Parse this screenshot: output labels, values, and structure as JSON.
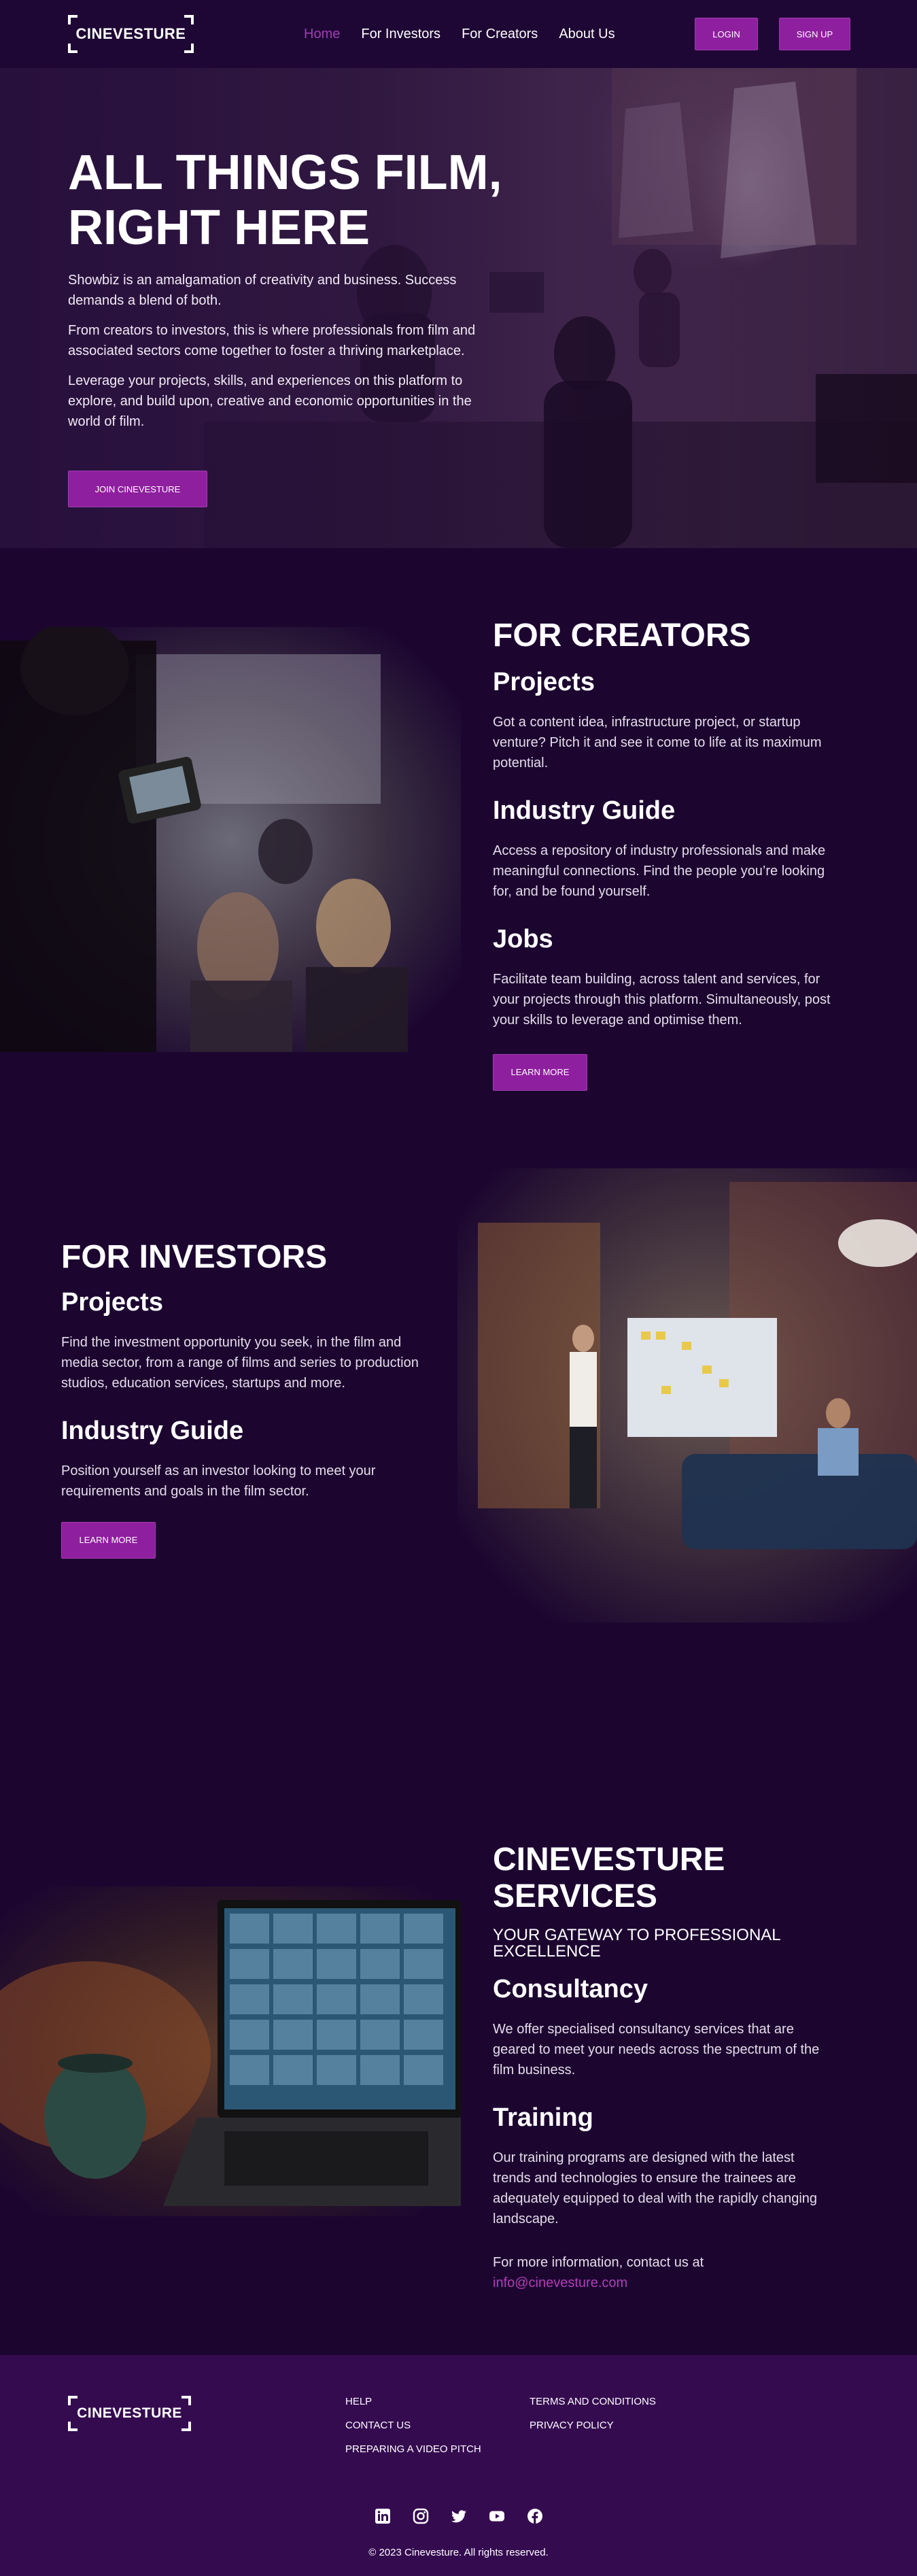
{
  "nav": {
    "logo": "CINEVESTURE",
    "links": [
      "Home",
      "For Investors",
      "For Creators",
      "About Us"
    ],
    "login": "LOGIN",
    "signup": "SIGN UP"
  },
  "hero": {
    "title_line1": "ALL THINGS FILM,",
    "title_line2": "RIGHT HERE",
    "paragraphs": [
      "Showbiz is an amalgamation of creativity and business. Success demands a blend of both.",
      "From creators to investors, this is where professionals from film and associated sectors come together to foster a thriving marketplace.",
      "Leverage your projects, skills, and experiences on this platform to explore, and build upon, creative and economic opportunities in the world of film."
    ],
    "cta": "JOIN CINEVESTURE"
  },
  "creators": {
    "title": "FOR CREATORS",
    "items": [
      {
        "heading": "Projects",
        "text": "Got a content idea, infrastructure project, or startup venture? Pitch it and see it come to life at its maximum potential."
      },
      {
        "heading": "Industry Guide",
        "text": "Access a repository of industry professionals and make meaningful connections. Find the people you’re looking for, and be found yourself."
      },
      {
        "heading": "Jobs",
        "text": "Facilitate team building, across talent and services, for your projects through this platform. Simultaneously, post your skills to leverage and optimise them."
      }
    ],
    "cta": "LEARN MORE"
  },
  "investors": {
    "title": "FOR INVESTORS",
    "items": [
      {
        "heading": "Projects",
        "text": "Find the investment opportunity you seek, in the film and media sector, from a range of films and series to production studios, education services, startups and more."
      },
      {
        "heading": "Industry Guide",
        "text": "Position yourself as an investor looking to meet your requirements and goals in the film sector."
      }
    ],
    "cta": "LEARN MORE"
  },
  "services": {
    "title_line1": "CINEVESTURE",
    "title_line2": "SERVICES",
    "tagline": "YOUR GATEWAY TO PROFESSIONAL EXCELLENCE",
    "items": [
      {
        "heading": "Consultancy",
        "text": "We offer specialised consultancy services that are geared to meet your needs across the spectrum of the film business."
      },
      {
        "heading": "Training",
        "text": "Our training programs are designed with the latest trends and technologies to ensure the trainees are adequately equipped to deal with the rapidly changing landscape."
      }
    ],
    "contact_text": "For more information, contact us at",
    "email": "info@cinevesture.com"
  },
  "footer": {
    "logo": "CINEVESTURE",
    "col1": [
      "HELP",
      "CONTACT US",
      "PREPARING A VIDEO PITCH"
    ],
    "col2": [
      "TERMS AND CONDITIONS",
      "PRIVACY POLICY"
    ],
    "socials": [
      "linkedin-icon",
      "instagram-icon",
      "twitter-icon",
      "youtube-icon",
      "facebook-icon"
    ],
    "copyright": "© 2023 Cinevesture.  All rights reserved."
  },
  "colors": {
    "background": "#1c0630",
    "nav": "#1e0734",
    "footer": "#350b50",
    "accent": "#8e1f9e",
    "active_link": "#a23cb4",
    "email_link": "#b03fb6"
  }
}
